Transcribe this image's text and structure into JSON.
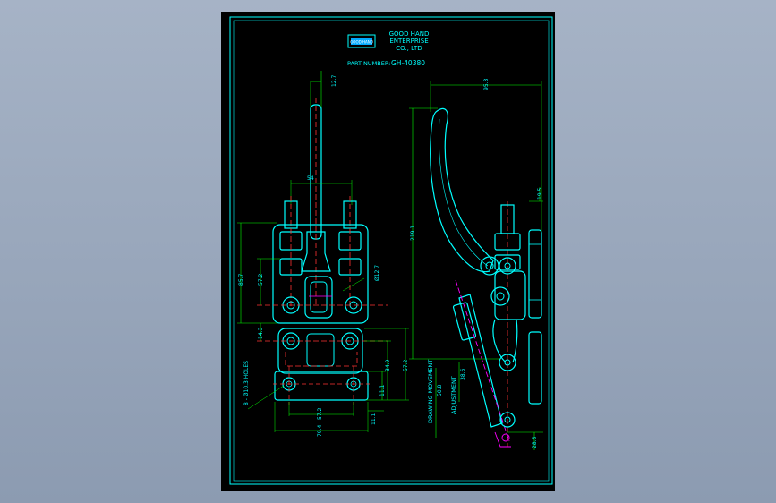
{
  "title_block": {
    "logo_text": "GOOD HAND",
    "company_line1": "GOOD HAND",
    "company_line2": "ENTERPRISE",
    "company_line3": "CO., LTD",
    "part_number_label": "PART NUMBER:",
    "part_number_value": "GH-40380"
  },
  "dimensions": {
    "top_pin": "12.7",
    "center_span": "54",
    "left_height": "85.7",
    "left_mid": "57.2",
    "left_low": "14.3",
    "rod_dia": "Ø12.7",
    "holes": "8 - Ø10.3 HOLES",
    "base_width_inner": "57.2",
    "base_width_outer": "79.4",
    "right_step": "11.1",
    "right_mid": "34.9",
    "right_tall": "57.2",
    "base_offset": "11.1",
    "side_width": "95.3",
    "side_height": "219.1",
    "side_top_right": "19.5",
    "drawing_movement_label": "DRAWING MOVEMENT",
    "drawing_movement_value": "50.8",
    "adjustment_label": "ADJUSTMENT",
    "adjustment_value": "38.6",
    "bottom_dim": "28.6"
  },
  "colors": {
    "background": "#a6b3c6",
    "sheet": "#000000",
    "drawing": "#00ffff",
    "dimension": "#00ff00",
    "centerline": "#ff3333",
    "accent": "#ff00ff",
    "text": "#ffffff"
  }
}
